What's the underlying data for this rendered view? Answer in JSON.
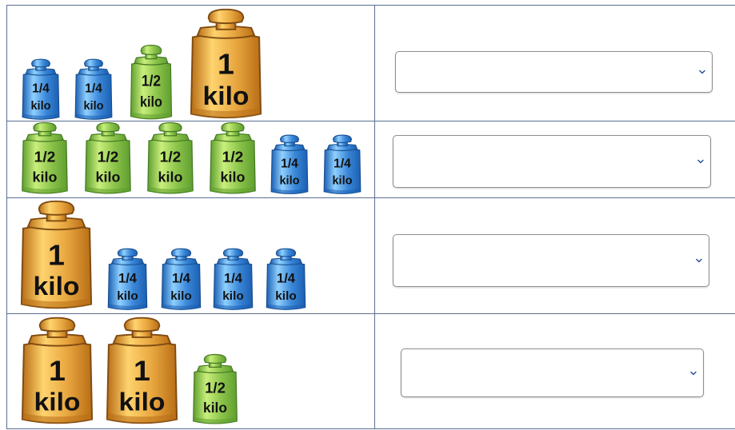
{
  "colors": {
    "grid_line": "#5b6f93",
    "gold_weight": "#e8a63f",
    "green_weight": "#8bc34a",
    "blue_weight": "#3a87d8",
    "dropdown_chevron": "#2f4f9e"
  },
  "weights": {
    "one_kilo": {
      "line1": "1",
      "line2": "kilo"
    },
    "half_kilo": {
      "line1": "1/2",
      "line2": "kilo"
    },
    "quarter_kilo": {
      "line1": "1/4",
      "line2": "kilo"
    }
  },
  "rows": [
    {
      "items": [
        "quarter_kilo",
        "quarter_kilo",
        "half_kilo",
        "one_kilo"
      ],
      "dropdown": {
        "value": "",
        "icon": "chevron-down-icon"
      }
    },
    {
      "items": [
        "half_kilo",
        "half_kilo",
        "half_kilo",
        "half_kilo",
        "quarter_kilo",
        "quarter_kilo"
      ],
      "dropdown": {
        "value": "",
        "icon": "chevron-down-icon"
      }
    },
    {
      "items": [
        "one_kilo",
        "quarter_kilo",
        "quarter_kilo",
        "quarter_kilo",
        "quarter_kilo"
      ],
      "dropdown": {
        "value": "",
        "icon": "chevron-down-icon"
      }
    },
    {
      "items": [
        "one_kilo",
        "one_kilo",
        "half_kilo"
      ],
      "dropdown": {
        "value": "",
        "icon": "chevron-down-icon"
      }
    }
  ]
}
